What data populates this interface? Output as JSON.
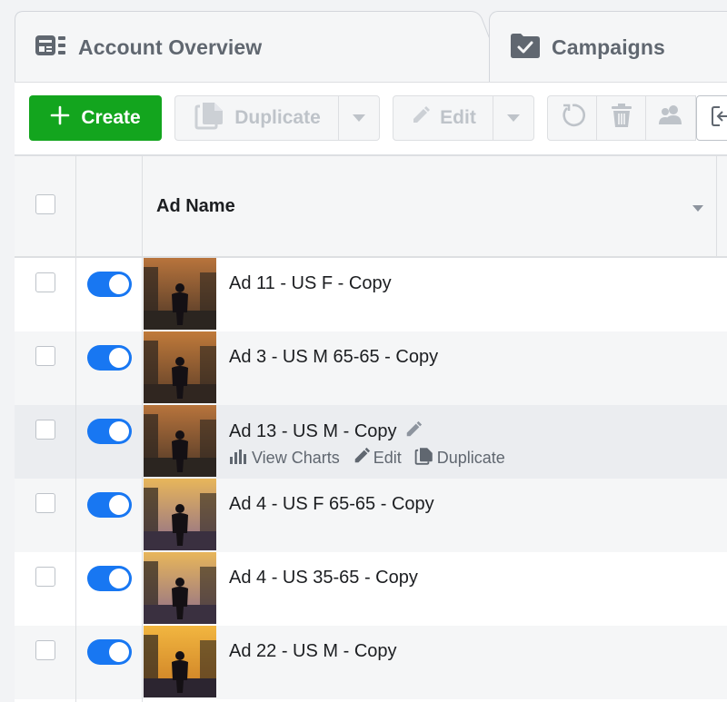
{
  "tabs": [
    {
      "label": "Account Overview",
      "icon": "account-overview-icon"
    },
    {
      "label": "Campaigns",
      "icon": "campaigns-folder-icon"
    }
  ],
  "toolbar": {
    "create_label": "Create",
    "duplicate_label": "Duplicate",
    "edit_label": "Edit"
  },
  "table": {
    "header": {
      "name": "Ad Name"
    },
    "rows": [
      {
        "name": "Ad 11 - US F - Copy",
        "enabled": true
      },
      {
        "name": "Ad 3 - US M 65-65 - Copy",
        "enabled": true
      },
      {
        "name": "Ad 13 - US M - Copy",
        "enabled": true,
        "hovered": true
      },
      {
        "name": "Ad 4 - US F 65-65 - Copy",
        "enabled": true
      },
      {
        "name": "Ad 4 - US 35-65 - Copy",
        "enabled": true
      },
      {
        "name": "Ad 22 - US M - Copy",
        "enabled": true
      }
    ],
    "row_actions": {
      "view_charts": "View Charts",
      "edit": "Edit",
      "duplicate": "Duplicate"
    }
  },
  "colors": {
    "create_green": "#13a51e",
    "toggle_blue": "#1877f2",
    "row_alt": "#f5f6f7",
    "row_hover": "#ebedf0"
  }
}
